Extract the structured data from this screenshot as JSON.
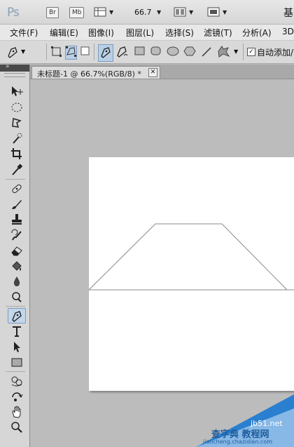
{
  "app": {
    "logo": "Ps",
    "badge_br": "Br",
    "badge_mb": "Mb",
    "zoom": "66.7",
    "title_cut": "基"
  },
  "menu": {
    "items": [
      "文件(F)",
      "编辑(E)",
      "图像(I)",
      "图层(L)",
      "选择(S)",
      "滤镜(T)",
      "分析(A)",
      "3D"
    ]
  },
  "options": {
    "auto_add_label": "自动添加/"
  },
  "document": {
    "tab_label": "未标题-1 @ 66.7%(RGB/8) *",
    "close_glyph": "✕"
  },
  "tools": [
    "move",
    "marquee",
    "lasso",
    "quick-select",
    "crop",
    "eyedropper",
    "spot-heal",
    "brush",
    "clone-stamp",
    "history-brush",
    "eraser",
    "paint-bucket",
    "blur",
    "dodge",
    "pen",
    "type",
    "path-select",
    "rectangle",
    "3d-rotate",
    "3d-orbit",
    "hand",
    "zoom"
  ],
  "active_tool": "pen",
  "watermark": {
    "line1": "jb51.net",
    "line2": "查字典 教程网",
    "line3": "jiaocheng.chazidian.com"
  },
  "colors": {
    "active_blue": "#c3d6ea",
    "canvas": "#ffffff",
    "workspace": "#bcbcbc",
    "watermark_blue": "#2a7fd0"
  }
}
